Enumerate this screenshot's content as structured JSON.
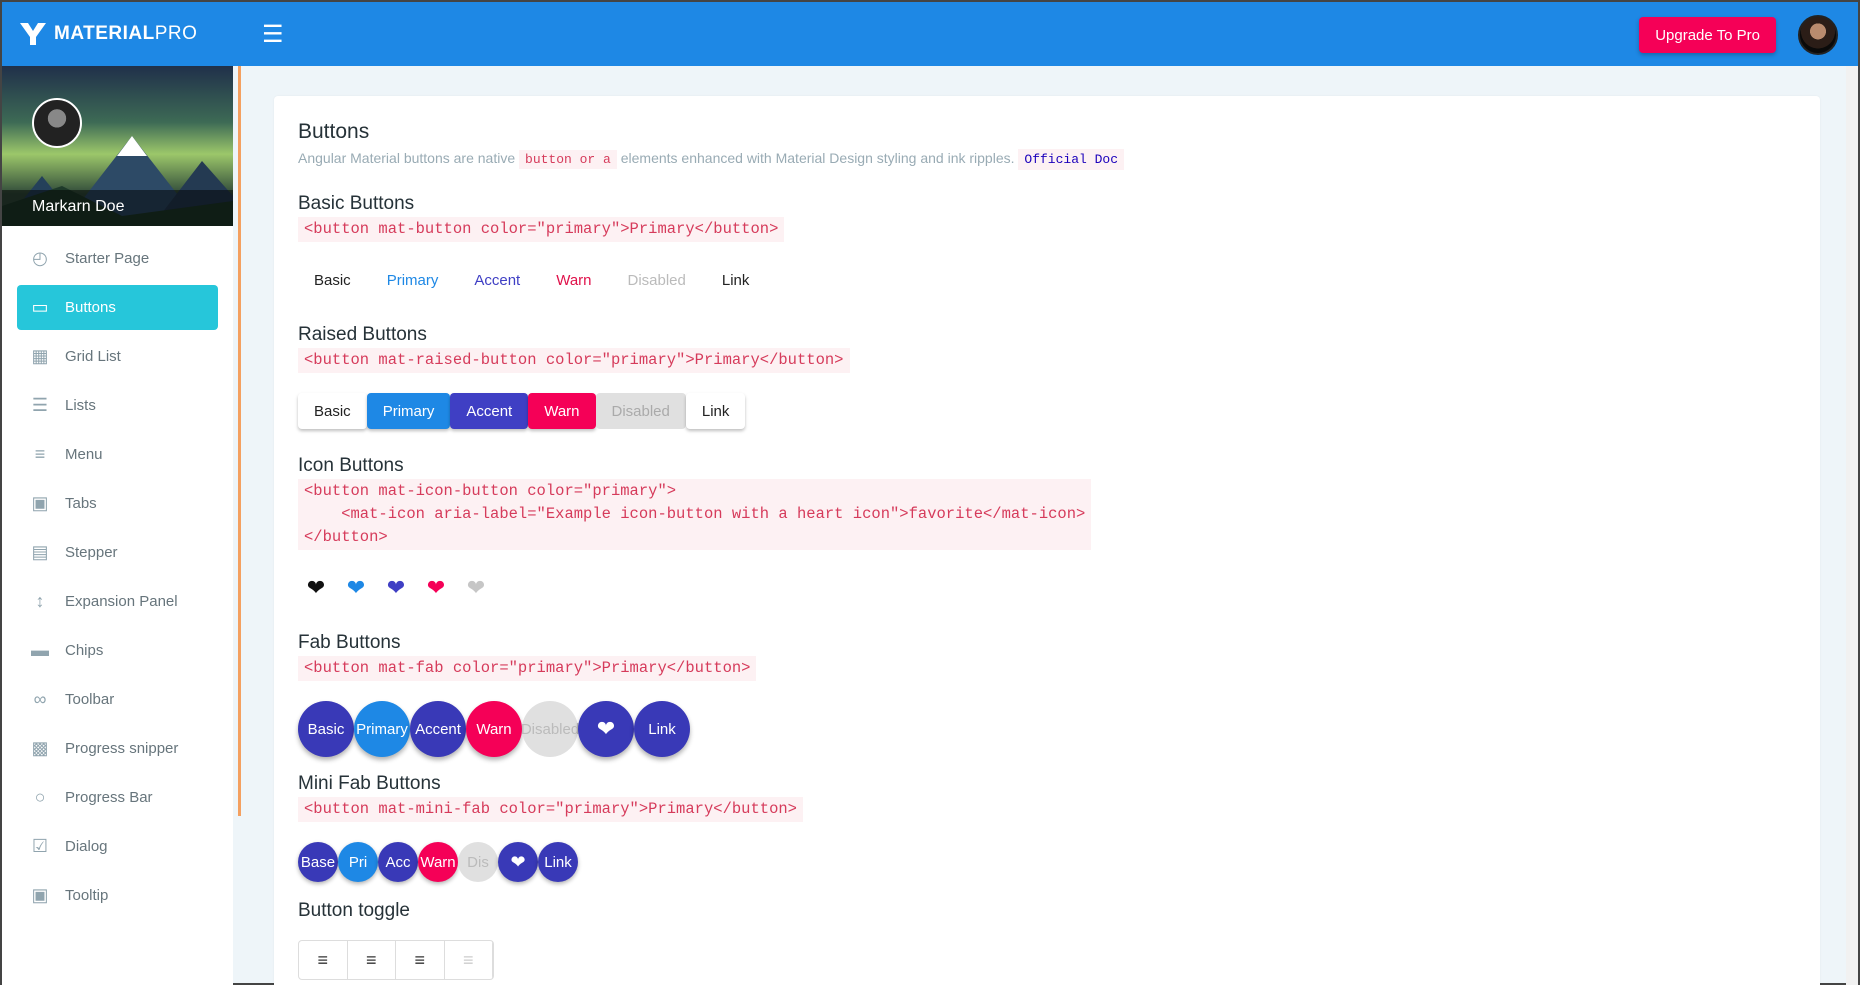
{
  "header": {
    "brand_bold": "MATERIAL",
    "brand_thin": "PRO",
    "upgrade_label": "Upgrade To Pro"
  },
  "sidebar": {
    "user_name": "Markarn Doe",
    "items": [
      {
        "label": "Starter Page",
        "icon": "gauge-icon"
      },
      {
        "label": "Buttons",
        "icon": "button-icon"
      },
      {
        "label": "Grid List",
        "icon": "grid-icon"
      },
      {
        "label": "Lists",
        "icon": "list-icon"
      },
      {
        "label": "Menu",
        "icon": "menu-icon"
      },
      {
        "label": "Tabs",
        "icon": "tab-icon"
      },
      {
        "label": "Stepper",
        "icon": "stepper-icon"
      },
      {
        "label": "Expansion Panel",
        "icon": "expand-icon"
      },
      {
        "label": "Chips",
        "icon": "chip-icon"
      },
      {
        "label": "Toolbar",
        "icon": "voicemail-icon"
      },
      {
        "label": "Progress snipper",
        "icon": "spinner-icon"
      },
      {
        "label": "Progress Bar",
        "icon": "progress-icon"
      },
      {
        "label": "Dialog",
        "icon": "dialog-icon"
      },
      {
        "label": "Tooltip",
        "icon": "tooltip-icon"
      }
    ]
  },
  "page": {
    "title": "Buttons",
    "subtitle_pre": "Angular Material buttons are native",
    "subtitle_code": "button or a",
    "subtitle_post": "elements enhanced with Material Design styling and ink ripples.",
    "doc_link": "Official Doc"
  },
  "basic": {
    "title": "Basic Buttons",
    "code": "<button mat-button color=\"primary\">Primary</button>",
    "buttons": [
      "Basic",
      "Primary",
      "Accent",
      "Warn",
      "Disabled",
      "Link"
    ]
  },
  "raised": {
    "title": "Raised Buttons",
    "code": "<button mat-raised-button color=\"primary\">Primary</button>",
    "buttons": [
      "Basic",
      "Primary",
      "Accent",
      "Warn",
      "Disabled",
      "Link"
    ]
  },
  "icon": {
    "title": "Icon Buttons",
    "code": "<button mat-icon-button color=\"primary\">\n    <mat-icon aria-label=\"Example icon-button with a heart icon\">favorite</mat-icon>\n</button>"
  },
  "fab": {
    "title": "Fab Buttons",
    "code": "<button mat-fab color=\"primary\">Primary</button>",
    "buttons": [
      "Basic",
      "Primary",
      "Accent",
      "Warn",
      "Disabled",
      "Link"
    ]
  },
  "minifab": {
    "title": "Mini Fab Buttons",
    "code": "<button mat-mini-fab color=\"primary\">Primary</button>",
    "buttons": [
      "Base",
      "Pri",
      "Acc",
      "Warn",
      "Dis",
      "Link"
    ]
  },
  "toggle": {
    "title": "Button toggle"
  },
  "colors": {
    "primary": "#1e88e5",
    "accent": "#3f3fc4",
    "warn": "#f50057",
    "sidebar_active": "#26c6da"
  }
}
